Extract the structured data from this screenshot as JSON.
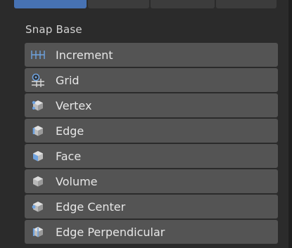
{
  "section": {
    "title": "Snap Base"
  },
  "items": [
    {
      "label": "Increment",
      "icon": "increment-icon"
    },
    {
      "label": "Grid",
      "icon": "grid-icon"
    },
    {
      "label": "Vertex",
      "icon": "vertex-icon"
    },
    {
      "label": "Edge",
      "icon": "edge-icon"
    },
    {
      "label": "Face",
      "icon": "face-icon"
    },
    {
      "label": "Volume",
      "icon": "volume-icon"
    },
    {
      "label": "Edge Center",
      "icon": "edge-center-icon"
    },
    {
      "label": "Edge Perpendicular",
      "icon": "edge-perpendicular-icon"
    }
  ],
  "colors": {
    "panel_bg": "#2b2b2b",
    "item_bg": "#545454",
    "text": "#e6e6e6",
    "icon_blue": "#6fa3e0",
    "tab_active": "#4772b3"
  }
}
